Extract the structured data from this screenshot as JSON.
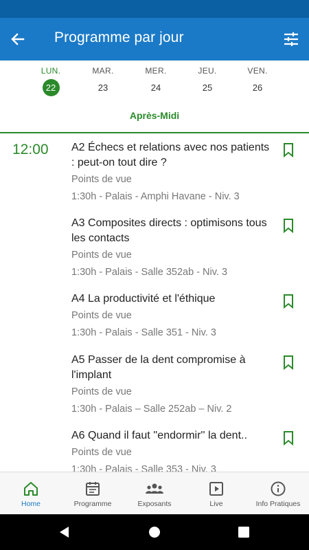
{
  "appbar": {
    "title": "Programme par jour",
    "back_icon": "arrow-left-icon",
    "filter_icon": "sliders-icon"
  },
  "days": [
    {
      "name": "LUN.",
      "num": "22",
      "active": true
    },
    {
      "name": "MAR.",
      "num": "23",
      "active": false
    },
    {
      "name": "MER.",
      "num": "24",
      "active": false
    },
    {
      "name": "JEU.",
      "num": "25",
      "active": false
    },
    {
      "name": "VEN.",
      "num": "26",
      "active": false
    }
  ],
  "period": "Après-Midi",
  "time_slot": "12:00",
  "sessions": [
    {
      "title": "A2 Échecs et relations avec nos patients : peut-on tout dire ?",
      "category": "Points de vue",
      "location": "1:30h - Palais - Amphi Havane - Niv. 3"
    },
    {
      "title": "A3 Composites directs : optimisons tous les contacts",
      "category": "Points de vue",
      "location": "1:30h - Palais - Salle 352ab - Niv. 3"
    },
    {
      "title": "A4 La productivité et l'éthique",
      "category": "Points de vue",
      "location": "1:30h - Palais - Salle 351 - Niv. 3"
    },
    {
      "title": "A5 Passer de la dent compromise à l'implant",
      "category": "Points de vue",
      "location": "1:30h - Palais – Salle 252ab – Niv. 2"
    },
    {
      "title": "A6 Quand il faut ''endormir'' la dent..",
      "category": "Points de vue",
      "location": "1:30h - Palais - Salle 353 - Niv. 3"
    }
  ],
  "nav": [
    {
      "label": "Home",
      "icon": "home-icon",
      "active": true
    },
    {
      "label": "Programme",
      "icon": "calendar-icon",
      "active": false
    },
    {
      "label": "Exposants",
      "icon": "people-icon",
      "active": false
    },
    {
      "label": "Live",
      "icon": "play-icon",
      "active": false
    },
    {
      "label": "Info Pratiques",
      "icon": "info-icon",
      "active": false
    }
  ],
  "colors": {
    "appbar": "#1b7ac7",
    "statusbar": "#0b5fa3",
    "accent_green": "#2a8a2a",
    "nav_active": "#1b7ac7"
  }
}
